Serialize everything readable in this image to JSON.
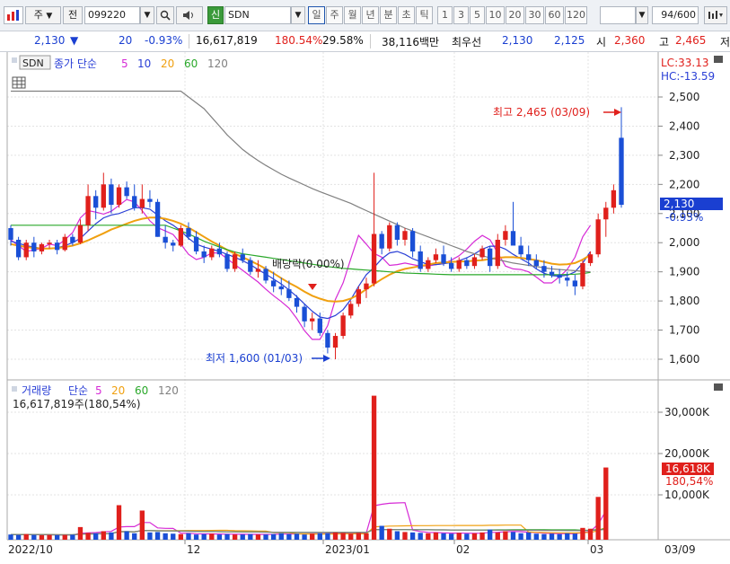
{
  "toolbar": {
    "market": "주",
    "jeon": "전",
    "code": "099220",
    "new_badge": "신",
    "name": "SDN",
    "periods": [
      "일",
      "주",
      "월",
      "년",
      "분",
      "초",
      "틱"
    ],
    "active_period": "일",
    "intervals": [
      "1",
      "3",
      "5",
      "10",
      "20",
      "30",
      "60",
      "120"
    ],
    "count": "94",
    "count_total": "/600"
  },
  "quote": {
    "price": "2,130",
    "direction": "▼",
    "change": "20",
    "change_pct": "-0.93%",
    "volume": "16,617,819",
    "volume_ratio": "180.54%",
    "turnover": "29.58%",
    "trade_amount": "38,116백만",
    "pref_label": "최우선",
    "ask": "2,130",
    "bid": "2,125",
    "open_label": "시",
    "open": "2,360",
    "high_label": "고",
    "high": "2,465",
    "low_label": "저"
  },
  "price_panel": {
    "legend_name": "SDN",
    "legend_ma": "종가 단순",
    "lc": "LC:33.13",
    "hc": "HC:-13.59",
    "high_annot": "최고 2,465 (03/09)",
    "low_annot": "최저 1,600 (01/03)",
    "event_annot": "배당락(0.00%)",
    "price_tag": "2,130",
    "price_tag_pct": "-0.93%"
  },
  "volume_panel": {
    "legend_name": "거래량",
    "legend_ma": "단순",
    "current": "16,617,819주(180,54%)",
    "tag": "16,618K",
    "tag_pct": "180,54%"
  },
  "colors": {
    "up": "#e0201c",
    "down": "#1a4fd6",
    "ma5": "#d62ad6",
    "ma10": "#2a3fd6",
    "ma20": "#f0a010",
    "ma60": "#2aa82a",
    "ma120": "#808080"
  },
  "chart_data": [
    {
      "type": "candlestick",
      "title": "SDN",
      "ylim": [
        1550,
        2570
      ],
      "y_ticks": [
        "2,500",
        "2,400",
        "2,300",
        "2,200",
        "2,100",
        "2,000",
        "1,900",
        "1,800",
        "1,700",
        "1,600"
      ],
      "x_ticks": [
        "2022/10",
        "12",
        "2023/01",
        "02",
        "03",
        "03/09"
      ],
      "moving_averages": [
        {
          "name": "5",
          "values": [
            2010,
            1990,
            1970,
            1975,
            1980,
            1995,
            1990,
            2010,
            2035,
            2085,
            2110,
            2105,
            2098,
            2108,
            2128,
            2148,
            2140,
            2110,
            2075,
            2052,
            2040,
            2028,
            1995,
            1960,
            1942,
            1950,
            1965,
            1965,
            1945,
            1925,
            1905,
            1885,
            1865,
            1840,
            1818,
            1798,
            1775,
            1740,
            1698,
            1668,
            1668,
            1715,
            1805,
            1862,
            1945,
            2025,
            1995,
            1963,
            1950,
            1922,
            1925,
            1930,
            1925,
            1920,
            1920,
            1925,
            1928,
            1940,
            1955,
            1978,
            2005,
            2025,
            2010,
            1965,
            1920,
            1910,
            1908,
            1900,
            1882,
            1862,
            1862,
            1883,
            1908,
            1950,
            2020,
            2060
          ]
        },
        {
          "name": "10",
          "values": [
            2005,
            1998,
            1990,
            1985,
            1980,
            1980,
            1982,
            1990,
            2000,
            2015,
            2040,
            2065,
            2085,
            2095,
            2100,
            2110,
            2120,
            2120,
            2115,
            2095,
            2075,
            2060,
            2040,
            2015,
            1995,
            1985,
            1978,
            1970,
            1960,
            1950,
            1938,
            1925,
            1908,
            1892,
            1875,
            1858,
            1838,
            1815,
            1790,
            1765,
            1745,
            1740,
            1750,
            1770,
            1805,
            1850,
            1890,
            1915,
            1945,
            1965,
            1970,
            1960,
            1945,
            1935,
            1925,
            1925,
            1928,
            1932,
            1938,
            1948,
            1962,
            1978,
            1988,
            1988,
            1978,
            1960,
            1945,
            1930,
            1910,
            1895,
            1887,
            1885,
            1888,
            1900,
            1930,
            1970
          ]
        },
        {
          "name": "20",
          "values": [
            1995,
            1990,
            1985,
            1982,
            1980,
            1980,
            1982,
            1985,
            1990,
            1998,
            2008,
            2020,
            2032,
            2045,
            2055,
            2065,
            2075,
            2082,
            2086,
            2086,
            2082,
            2075,
            2065,
            2052,
            2036,
            2020,
            2004,
            1990,
            1975,
            1962,
            1950,
            1938,
            1925,
            1910,
            1895,
            1878,
            1862,
            1848,
            1832,
            1818,
            1808,
            1800,
            1798,
            1800,
            1808,
            1822,
            1840,
            1858,
            1875,
            1890,
            1902,
            1910,
            1915,
            1920,
            1925,
            1930,
            1932,
            1934,
            1935,
            1936,
            1938,
            1940,
            1944,
            1948,
            1950,
            1950,
            1948,
            1944,
            1940,
            1934,
            1928,
            1925,
            1926,
            1930,
            1942,
            1958
          ]
        },
        {
          "name": "60",
          "values": [
            2060,
            2060,
            2060,
            2060,
            2060,
            2060,
            2060,
            2060,
            2060,
            2060,
            2060,
            2060,
            2060,
            2060,
            2060,
            2060,
            2060,
            2060,
            2060,
            2060,
            2060,
            2050,
            2040,
            2030,
            2018,
            2005,
            1995,
            1985,
            1976,
            1968,
            1962,
            1958,
            1954,
            1950,
            1946,
            1942,
            1938,
            1934,
            1930,
            1926,
            1922,
            1918,
            1915,
            1912,
            1910,
            1908,
            1906,
            1904,
            1902,
            1900,
            1898,
            1896,
            1895,
            1894,
            1893,
            1892,
            1891,
            1890,
            1890,
            1890,
            1890,
            1890,
            1890,
            1890,
            1890,
            1890,
            1890,
            1890,
            1890,
            1890,
            1890,
            1890,
            1891,
            1892,
            1894,
            1898
          ]
        },
        {
          "name": "120",
          "values": [
            2520,
            2520,
            2520,
            2520,
            2520,
            2520,
            2520,
            2520,
            2520,
            2520,
            2520,
            2520,
            2520,
            2520,
            2520,
            2520,
            2520,
            2520,
            2520,
            2520,
            2520,
            2520,
            2520,
            2500,
            2480,
            2460,
            2430,
            2400,
            2370,
            2345,
            2320,
            2300,
            2282,
            2265,
            2250,
            2235,
            2222,
            2210,
            2198,
            2186,
            2175,
            2165,
            2155,
            2145,
            2135,
            2122,
            2110,
            2098,
            2086,
            2074,
            2062,
            2050,
            2040,
            2030,
            2020,
            2010,
            2000,
            1990,
            1980,
            1970,
            1962,
            1955,
            1948,
            1942,
            1936,
            1930,
            1926,
            1922,
            1918,
            1914,
            1910,
            1908,
            1906,
            1904,
            1902,
            1900
          ]
        }
      ],
      "candles": [
        [
          2050,
          2060,
          1990,
          2010
        ],
        [
          2010,
          2020,
          1940,
          1950
        ],
        [
          1950,
          2010,
          1940,
          2000
        ],
        [
          2000,
          2020,
          1950,
          1970
        ],
        [
          1970,
          2000,
          1960,
          1995
        ],
        [
          1995,
          2010,
          1980,
          2000
        ],
        [
          2000,
          2010,
          1960,
          1975
        ],
        [
          1975,
          2030,
          1970,
          2020
        ],
        [
          2020,
          2030,
          1990,
          2000
        ],
        [
          2000,
          2080,
          1995,
          2060
        ],
        [
          2060,
          2200,
          2040,
          2160
        ],
        [
          2160,
          2180,
          2080,
          2120
        ],
        [
          2120,
          2240,
          2110,
          2200
        ],
        [
          2200,
          2220,
          2100,
          2130
        ],
        [
          2130,
          2200,
          2120,
          2190
        ],
        [
          2190,
          2210,
          2150,
          2160
        ],
        [
          2160,
          2200,
          2110,
          2120
        ],
        [
          2120,
          2200,
          2100,
          2150
        ],
        [
          2150,
          2180,
          2120,
          2140
        ],
        [
          2140,
          2150,
          2020,
          2020
        ],
        [
          2020,
          2060,
          1980,
          2000
        ],
        [
          2000,
          2010,
          1970,
          1990
        ],
        [
          1990,
          2060,
          1985,
          2050
        ],
        [
          2050,
          2070,
          2010,
          2020
        ],
        [
          2020,
          2040,
          1960,
          1970
        ],
        [
          1970,
          1990,
          1930,
          1950
        ],
        [
          1950,
          1990,
          1940,
          1980
        ],
        [
          1980,
          2000,
          1950,
          1960
        ],
        [
          1960,
          1970,
          1900,
          1910
        ],
        [
          1910,
          1970,
          1900,
          1960
        ],
        [
          1960,
          1980,
          1930,
          1940
        ],
        [
          1940,
          1950,
          1890,
          1900
        ],
        [
          1900,
          1940,
          1880,
          1910
        ],
        [
          1910,
          1920,
          1860,
          1870
        ],
        [
          1870,
          1900,
          1830,
          1850
        ],
        [
          1850,
          1880,
          1820,
          1840
        ],
        [
          1840,
          1870,
          1800,
          1810
        ],
        [
          1810,
          1820,
          1760,
          1780
        ],
        [
          1780,
          1790,
          1710,
          1730
        ],
        [
          1730,
          1760,
          1700,
          1740
        ],
        [
          1740,
          1760,
          1680,
          1690
        ],
        [
          1690,
          1700,
          1620,
          1640
        ],
        [
          1640,
          1690,
          1600,
          1680
        ],
        [
          1680,
          1760,
          1670,
          1750
        ],
        [
          1750,
          1800,
          1740,
          1790
        ],
        [
          1790,
          1850,
          1780,
          1840
        ],
        [
          1840,
          1880,
          1810,
          1860
        ],
        [
          1860,
          2240,
          1850,
          2030
        ],
        [
          2030,
          2040,
          1960,
          1980
        ],
        [
          1980,
          2070,
          1970,
          2060
        ],
        [
          2060,
          2070,
          1990,
          2010
        ],
        [
          2010,
          2050,
          1990,
          2040
        ],
        [
          2040,
          2050,
          1950,
          1970
        ],
        [
          1970,
          1990,
          1900,
          1910
        ],
        [
          1910,
          1950,
          1900,
          1940
        ],
        [
          1940,
          1980,
          1930,
          1960
        ],
        [
          1960,
          1990,
          1920,
          1930
        ],
        [
          1930,
          1950,
          1900,
          1910
        ],
        [
          1910,
          1950,
          1900,
          1940
        ],
        [
          1940,
          1950,
          1910,
          1920
        ],
        [
          1920,
          1960,
          1910,
          1950
        ],
        [
          1950,
          1990,
          1940,
          1980
        ],
        [
          1980,
          1990,
          1900,
          1920
        ],
        [
          1920,
          2030,
          1910,
          2010
        ],
        [
          2010,
          2060,
          1990,
          2040
        ],
        [
          2040,
          2140,
          2000,
          1990
        ],
        [
          1990,
          2020,
          1950,
          1960
        ],
        [
          1960,
          1990,
          1920,
          1940
        ],
        [
          1940,
          1960,
          1910,
          1920
        ],
        [
          1920,
          1940,
          1880,
          1900
        ],
        [
          1900,
          1920,
          1880,
          1890
        ],
        [
          1890,
          1910,
          1860,
          1880
        ],
        [
          1880,
          1900,
          1850,
          1870
        ],
        [
          1870,
          1890,
          1820,
          1850
        ],
        [
          1850,
          1940,
          1840,
          1930
        ],
        [
          1930,
          1970,
          1920,
          1960
        ],
        [
          1960,
          2100,
          1950,
          2080
        ],
        [
          2080,
          2140,
          2020,
          2120
        ],
        [
          2120,
          2200,
          2100,
          2180
        ],
        [
          2360,
          2465,
          2120,
          2130
        ]
      ]
    },
    {
      "type": "bar",
      "title": "거래량",
      "ylim": [
        0,
        36000
      ],
      "y_ticks": [
        "30,000K",
        "20,000K",
        "10,000K"
      ],
      "values_k": [
        400,
        300,
        500,
        300,
        250,
        300,
        250,
        300,
        350,
        2200,
        800,
        700,
        1200,
        900,
        7500,
        1200,
        700,
        6200,
        900,
        1000,
        700,
        600,
        500,
        700,
        400,
        500,
        600,
        400,
        500,
        400,
        400,
        500,
        400,
        400,
        500,
        700,
        500,
        600,
        400,
        600,
        700,
        700,
        900,
        800,
        600,
        800,
        700,
        34000,
        2500,
        1800,
        1200,
        1000,
        900,
        800,
        700,
        900,
        700,
        600,
        800,
        600,
        700,
        900,
        1600,
        900,
        1200,
        1000,
        700,
        900,
        600,
        500,
        600,
        500,
        700,
        600,
        2000,
        1800,
        9500,
        16618
      ]
    }
  ]
}
